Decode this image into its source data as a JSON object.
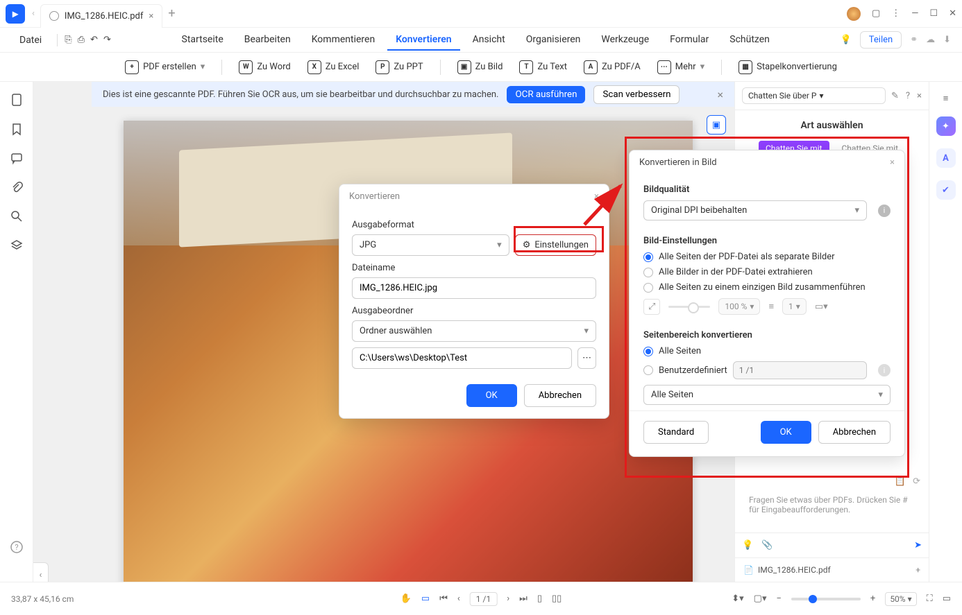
{
  "titlebar": {
    "filename": "IMG_1286.HEIC.pdf"
  },
  "menu": {
    "datei": "Datei",
    "items": [
      "Startseite",
      "Bearbeiten",
      "Kommentieren",
      "Konvertieren",
      "Ansicht",
      "Organisieren",
      "Werkzeuge",
      "Formular",
      "Schützen"
    ],
    "share": "Teilen"
  },
  "toolbar": {
    "pdf_create": "PDF erstellen",
    "to_word": "Zu Word",
    "to_excel": "Zu Excel",
    "to_ppt": "Zu PPT",
    "to_image": "Zu Bild",
    "to_text": "Zu Text",
    "to_pdfa": "Zu PDF/A",
    "more": "Mehr",
    "batch": "Stapelkonvertierung"
  },
  "ocr_banner": {
    "text": "Dies ist eine gescannte PDF. Führen Sie OCR aus, um sie bearbeitbar und durchsuchbar zu machen.",
    "run_ocr": "OCR ausführen",
    "improve_scan": "Scan verbessern"
  },
  "right_panel": {
    "chat_dropdown": "Chatten Sie über P",
    "title": "Art auswählen",
    "tab_active": "Chatten Sie mit",
    "tab_inactive": "Chatten Sie mit",
    "prompt_placeholder": "Fragen Sie etwas über PDFs. Drücken Sie # für Eingabeaufforderungen.",
    "file_tab": "IMG_1286.HEIC.pdf"
  },
  "convert_dialog": {
    "title": "Konvertieren",
    "format_label": "Ausgabeformat",
    "format_value": "JPG",
    "settings_btn": "Einstellungen",
    "filename_label": "Dateiname",
    "filename_value": "IMG_1286.HEIC.jpg",
    "folder_label": "Ausgabeordner",
    "folder_select": "Ordner auswählen",
    "folder_path": "C:\\Users\\ws\\Desktop\\Test",
    "ok": "OK",
    "cancel": "Abbrechen"
  },
  "settings_dialog": {
    "title": "Konvertieren in Bild",
    "quality_label": "Bildqualität",
    "quality_value": "Original DPI beibehalten",
    "image_settings_label": "Bild-Einstellungen",
    "opt_separate": "Alle Seiten der PDF-Datei als separate Bilder",
    "opt_extract": "Alle Bilder in der PDF-Datei extrahieren",
    "opt_merge": "Alle Seiten zu einem einzigen Bild zusammenführen",
    "zoom_pct": "100 %",
    "one": "1",
    "range_label": "Seitenbereich konvertieren",
    "opt_all": "Alle Seiten",
    "opt_custom": "Benutzerdefiniert",
    "custom_placeholder": "1 /1",
    "all_pages_select": "Alle Seiten",
    "standard": "Standard",
    "ok": "OK",
    "cancel": "Abbrechen"
  },
  "bottom_bar": {
    "coords": "33,87 x 45,16 cm",
    "page": "1 /1",
    "zoom": "50%"
  }
}
